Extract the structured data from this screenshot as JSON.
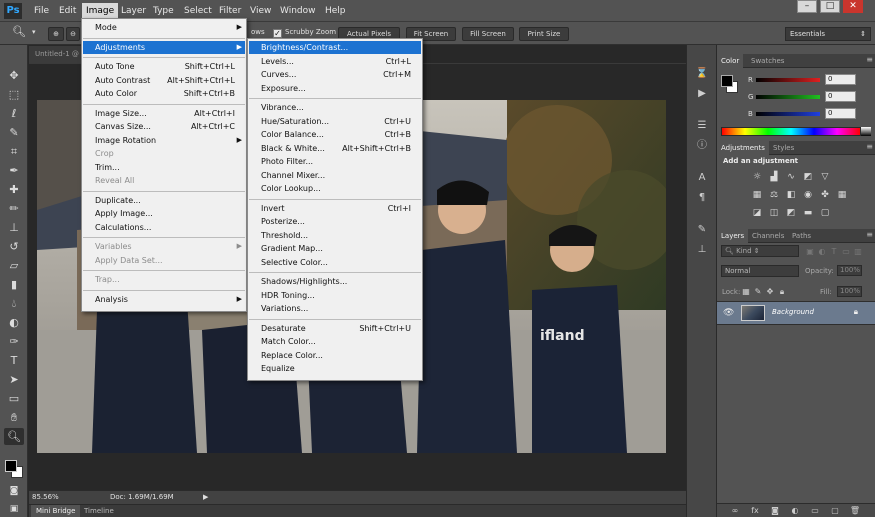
{
  "menubar": {
    "logo": "Ps",
    "items": [
      "File",
      "Edit",
      "Image",
      "Layer",
      "Type",
      "Select",
      "Filter",
      "View",
      "Window",
      "Help"
    ],
    "window_controls": [
      "–",
      "□",
      "✕"
    ]
  },
  "options_bar": {
    "resize_partial": "ows",
    "scrubby_zoom_label": "Scrubby Zoom",
    "scrubby_zoom_checked": true,
    "actual_pixels": "Actual Pixels",
    "fit_screen": "Fit Screen",
    "fill_screen": "Fill Screen",
    "print_size": "Print Size",
    "workspace": "Essentials"
  },
  "document": {
    "tab_label": "Untitled-1 @",
    "zoom_level": "85.56%",
    "doc_info": "Doc: 1.69M/1.69M"
  },
  "bottom_tabs": [
    "Mini Bridge",
    "Timeline"
  ],
  "image_menu": [
    {
      "label": "Mode",
      "submenu": true
    },
    {
      "separator": true
    },
    {
      "label": "Adjustments",
      "submenu": true,
      "highlight": true
    },
    {
      "separator": true
    },
    {
      "label": "Auto Tone",
      "shortcut": "Shift+Ctrl+L"
    },
    {
      "label": "Auto Contrast",
      "shortcut": "Alt+Shift+Ctrl+L"
    },
    {
      "label": "Auto Color",
      "shortcut": "Shift+Ctrl+B"
    },
    {
      "separator": true
    },
    {
      "label": "Image Size...",
      "shortcut": "Alt+Ctrl+I"
    },
    {
      "label": "Canvas Size...",
      "shortcut": "Alt+Ctrl+C"
    },
    {
      "label": "Image Rotation",
      "submenu": true
    },
    {
      "label": "Crop",
      "disabled": true
    },
    {
      "label": "Trim..."
    },
    {
      "label": "Reveal All",
      "disabled": true
    },
    {
      "separator": true
    },
    {
      "label": "Duplicate..."
    },
    {
      "label": "Apply Image..."
    },
    {
      "label": "Calculations..."
    },
    {
      "separator": true
    },
    {
      "label": "Variables",
      "submenu": true,
      "disabled": true
    },
    {
      "label": "Apply Data Set...",
      "disabled": true
    },
    {
      "separator": true
    },
    {
      "label": "Trap...",
      "disabled": true
    },
    {
      "separator": true
    },
    {
      "label": "Analysis",
      "submenu": true
    }
  ],
  "adjustments_menu": [
    {
      "label": "Brightness/Contrast...",
      "highlight": true
    },
    {
      "label": "Levels...",
      "shortcut": "Ctrl+L"
    },
    {
      "label": "Curves...",
      "shortcut": "Ctrl+M"
    },
    {
      "label": "Exposure..."
    },
    {
      "separator": true
    },
    {
      "label": "Vibrance..."
    },
    {
      "label": "Hue/Saturation...",
      "shortcut": "Ctrl+U"
    },
    {
      "label": "Color Balance...",
      "shortcut": "Ctrl+B"
    },
    {
      "label": "Black & White...",
      "shortcut": "Alt+Shift+Ctrl+B"
    },
    {
      "label": "Photo Filter..."
    },
    {
      "label": "Channel Mixer..."
    },
    {
      "label": "Color Lookup..."
    },
    {
      "separator": true
    },
    {
      "label": "Invert",
      "shortcut": "Ctrl+I"
    },
    {
      "label": "Posterize..."
    },
    {
      "label": "Threshold..."
    },
    {
      "label": "Gradient Map..."
    },
    {
      "label": "Selective Color..."
    },
    {
      "separator": true
    },
    {
      "label": "Shadows/Highlights..."
    },
    {
      "label": "HDR Toning..."
    },
    {
      "label": "Variations..."
    },
    {
      "separator": true
    },
    {
      "label": "Desaturate",
      "shortcut": "Shift+Ctrl+U"
    },
    {
      "label": "Match Color..."
    },
    {
      "label": "Replace Color..."
    },
    {
      "label": "Equalize"
    }
  ],
  "color_panel": {
    "tabs": [
      "Color",
      "Swatches"
    ],
    "channels": [
      {
        "label": "R",
        "value": "0",
        "color": "#e02020"
      },
      {
        "label": "G",
        "value": "0",
        "color": "#20c020"
      },
      {
        "label": "B",
        "value": "0",
        "color": "#2040e0"
      }
    ]
  },
  "adjustments_panel": {
    "tabs": [
      "Adjustments",
      "Styles"
    ],
    "title": "Add an adjustment"
  },
  "layers_panel": {
    "tabs": [
      "Layers",
      "Channels",
      "Paths"
    ],
    "kind_label": "Kind",
    "blend_mode": "Normal",
    "opacity_label": "Opacity:",
    "opacity_value": "100%",
    "lock_label": "Lock:",
    "fill_label": "Fill:",
    "fill_value": "100%",
    "layers": [
      {
        "name": "Background",
        "visible": true,
        "locked": true
      }
    ]
  },
  "tools": [
    "move",
    "marquee",
    "lasso",
    "quick-select",
    "crop",
    "eyedropper",
    "healing",
    "brush",
    "clone-stamp",
    "history-brush",
    "eraser",
    "gradient",
    "blur",
    "dodge",
    "pen",
    "type",
    "path-select",
    "shape",
    "hand",
    "zoom"
  ],
  "colors": {
    "menubar": "#535353",
    "menu_highlight": "#1c72d1",
    "layer_selected": "#6b7a8e"
  }
}
